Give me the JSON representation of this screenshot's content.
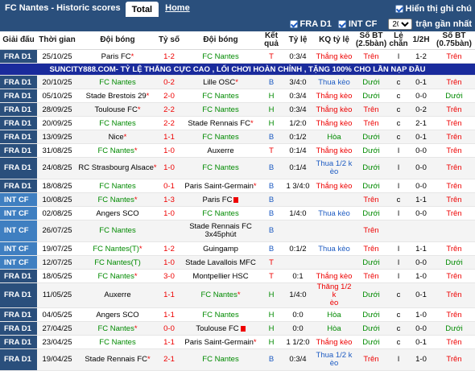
{
  "header": {
    "title": "FC Nantes - Historic scores",
    "tab_total": "Total",
    "tab_home": "Home",
    "show_detail": "Hiển thị ghi chú"
  },
  "filter": {
    "fra_d1": "FRA D1",
    "int_cf": "INT CF",
    "count": "20",
    "suffix": "trận gần nhất"
  },
  "columns": [
    "Giải đấu",
    "Thời gian",
    "Đội bóng",
    "Tỷ số",
    "Đội bóng",
    "Kết quả",
    "Tỷ lệ",
    "KQ tỷ lệ",
    "Số BT (2.5bàn)",
    "Lẻ chẵn",
    "1/2H",
    "Số BT (0.75bàn)"
  ],
  "ad_text": "SUNCITY888.COM- TỶ LỆ THẮNG CỰC CAO , LỐI CHƠI HOÀN CHỈNH , TẶNG 100% CHO LẦN NẠP ĐẦU",
  "colors": {
    "header_bg": "#2a4f7c",
    "cup_bg": "#3f7fc1",
    "win": "#e00000",
    "draw": "#008a00",
    "loss": "#1d5bc2",
    "ad_bg": "#1a2b9c"
  },
  "rows": [
    {
      "comp": "FRA D1",
      "date": "25/10/25",
      "home": "Paris FC",
      "home_star": "*",
      "score": "1-2",
      "away": "FC Nantes",
      "away_star": "",
      "res": "T",
      "odds": "0:3/4",
      "oddres": "Thắng kèo",
      "ou": "Trên",
      "oe": "l",
      "ht": "1-2",
      "ou2": "Trên"
    },
    {
      "comp": "FRA D1",
      "date": "20/10/25",
      "home": "FC Nantes",
      "home_star": "",
      "score": "0-2",
      "away": "Lille OSC",
      "away_star": "*",
      "res": "B",
      "odds": "3/4:0",
      "oddres": "Thua kèo",
      "ou": "Dưới",
      "oe": "c",
      "ht": "0-1",
      "ou2": "Trên"
    },
    {
      "comp": "FRA D1",
      "date": "05/10/25",
      "home": "Stade Brestois 29",
      "home_star": "*",
      "score": "2-0",
      "away": "FC Nantes",
      "away_star": "",
      "res": "H",
      "odds": "0:3/4",
      "oddres": "Thắng kèo",
      "ou": "Dưới",
      "oe": "c",
      "ht": "0-0",
      "ou2": "Dưới"
    },
    {
      "comp": "FRA D1",
      "date": "28/09/25",
      "home": "Toulouse FC",
      "home_star": "*",
      "score": "2-2",
      "away": "FC Nantes",
      "away_star": "",
      "res": "H",
      "odds": "0:3/4",
      "oddres": "Thắng kèo",
      "ou": "Trên",
      "oe": "c",
      "ht": "0-2",
      "ou2": "Trên"
    },
    {
      "comp": "FRA D1",
      "date": "20/09/25",
      "home": "FC Nantes",
      "home_star": "",
      "score": "2-2",
      "away": "Stade Rennais FC",
      "away_star": "*",
      "res": "H",
      "odds": "1/2:0",
      "oddres": "Thắng kèo",
      "ou": "Trên",
      "oe": "c",
      "ht": "2-1",
      "ou2": "Trên"
    },
    {
      "comp": "FRA D1",
      "date": "13/09/25",
      "home": "Nice",
      "home_star": "*",
      "score": "1-1",
      "away": "FC Nantes",
      "away_star": "",
      "res": "B",
      "odds": "0:1/2",
      "oddres": "Hòa",
      "ou": "Dưới",
      "oe": "c",
      "ht": "0-1",
      "ou2": "Trên"
    },
    {
      "comp": "FRA D1",
      "date": "31/08/25",
      "home": "FC Nantes",
      "home_star": "*",
      "score": "1-0",
      "away": "Auxerre",
      "away_star": "",
      "res": "T",
      "odds": "0:1/4",
      "oddres": "Thắng kèo",
      "ou": "Dưới",
      "oe": "l",
      "ht": "0-0",
      "ou2": "Trên"
    },
    {
      "comp": "FRA D1",
      "date": "24/08/25",
      "home": "RC Strasbourg Alsace",
      "home_star": "*",
      "score": "1-0",
      "away": "FC Nantes",
      "away_star": "",
      "res": "B",
      "odds": "0:1/4",
      "oddres": "Thua 1/2 k\nèo",
      "ou": "Dưới",
      "oe": "l",
      "ht": "0-0",
      "ou2": "Trên",
      "tall": true
    },
    {
      "comp": "FRA D1",
      "date": "18/08/25",
      "home": "FC Nantes",
      "home_star": "",
      "score": "0-1",
      "away": "Paris Saint-Germain",
      "away_star": "*",
      "res": "B",
      "odds": "1 3/4:0",
      "oddres": "Thắng kèo",
      "ou": "Dưới",
      "oe": "l",
      "ht": "0-0",
      "ou2": "Trên"
    },
    {
      "comp": "INT CF",
      "date": "10/08/25",
      "home": "FC Nantes",
      "home_star": "*",
      "score": "1-3",
      "away": "Paris FC",
      "away_star": "",
      "away_flag": true,
      "res": "B",
      "odds": "",
      "oddres": "",
      "ou": "Trên",
      "oe": "c",
      "ht": "1-1",
      "ou2": "Trên"
    },
    {
      "comp": "INT CF",
      "date": "02/08/25",
      "home": "Angers SCO",
      "home_star": "",
      "score": "1-0",
      "away": "FC Nantes",
      "away_star": "",
      "res": "B",
      "odds": "1/4:0",
      "oddres": "Thua kèo",
      "ou": "Dưới",
      "oe": "l",
      "ht": "0-0",
      "ou2": "Trên"
    },
    {
      "comp": "INT CF",
      "date": "26/07/25",
      "home": "FC Nantes",
      "home_star": "",
      "score": "",
      "away": "Stade Rennais FC",
      "away_star": "",
      "away_sub": "3x45phút",
      "res": "B",
      "odds": "",
      "oddres": "",
      "ou": "Trên",
      "oe": "",
      "ht": "",
      "ou2": "",
      "tall": true
    },
    {
      "comp": "INT CF",
      "date": "19/07/25",
      "home": "FC Nantes(T)",
      "home_star": "*",
      "score": "1-2",
      "away": "Guingamp",
      "away_star": "",
      "res": "B",
      "odds": "0:1/2",
      "oddres": "Thua kèo",
      "ou": "Trên",
      "oe": "l",
      "ht": "1-1",
      "ou2": "Trên"
    },
    {
      "comp": "INT CF",
      "date": "12/07/25",
      "home": "FC Nantes(T)",
      "home_star": "",
      "score": "1-0",
      "away": "Stade Lavallois MFC",
      "away_star": "",
      "res": "T",
      "odds": "",
      "oddres": "",
      "ou": "Dưới",
      "oe": "l",
      "ht": "0-0",
      "ou2": "Dưới"
    },
    {
      "comp": "FRA D1",
      "date": "18/05/25",
      "home": "FC Nantes",
      "home_star": "*",
      "score": "3-0",
      "away": "Montpellier HSC",
      "away_star": "",
      "res": "T",
      "odds": "0:1",
      "oddres": "Thắng kèo",
      "ou": "Trên",
      "oe": "l",
      "ht": "1-0",
      "ou2": "Trên"
    },
    {
      "comp": "FRA D1",
      "date": "11/05/25",
      "home": "Auxerre",
      "home_star": "",
      "score": "1-1",
      "away": "FC Nantes",
      "away_star": "*",
      "res": "H",
      "odds": "1/4:0",
      "oddres": "Thắng 1/2 k\nèo",
      "ou": "Dưới",
      "oe": "c",
      "ht": "0-1",
      "ou2": "Trên",
      "tall": true
    },
    {
      "comp": "FRA D1",
      "date": "04/05/25",
      "home": "Angers SCO",
      "home_star": "",
      "score": "1-1",
      "away": "FC Nantes",
      "away_star": "",
      "res": "H",
      "odds": "0:0",
      "oddres": "Hòa",
      "ou": "Dưới",
      "oe": "c",
      "ht": "1-0",
      "ou2": "Trên"
    },
    {
      "comp": "FRA D1",
      "date": "27/04/25",
      "home": "FC Nantes",
      "home_star": "*",
      "score": "0-0",
      "away": "Toulouse FC",
      "away_star": "",
      "away_flag": true,
      "res": "H",
      "odds": "0:0",
      "oddres": "Hòa",
      "ou": "Dưới",
      "oe": "c",
      "ht": "0-0",
      "ou2": "Dưới"
    },
    {
      "comp": "FRA D1",
      "date": "23/04/25",
      "home": "FC Nantes",
      "home_star": "",
      "score": "1-1",
      "away": "Paris Saint-Germain",
      "away_star": "*",
      "res": "H",
      "odds": "1 1/2:0",
      "oddres": "Thắng kèo",
      "ou": "Dưới",
      "oe": "c",
      "ht": "0-1",
      "ou2": "Trên"
    },
    {
      "comp": "FRA D1",
      "date": "19/04/25",
      "home": "Stade Rennais FC",
      "home_star": "*",
      "score": "2-1",
      "away": "FC Nantes",
      "away_star": "",
      "res": "B",
      "odds": "0:3/4",
      "oddres": "Thua 1/2 k\nèo",
      "ou": "Trên",
      "oe": "l",
      "ht": "1-0",
      "ou2": "Trên",
      "tall": true
    }
  ]
}
